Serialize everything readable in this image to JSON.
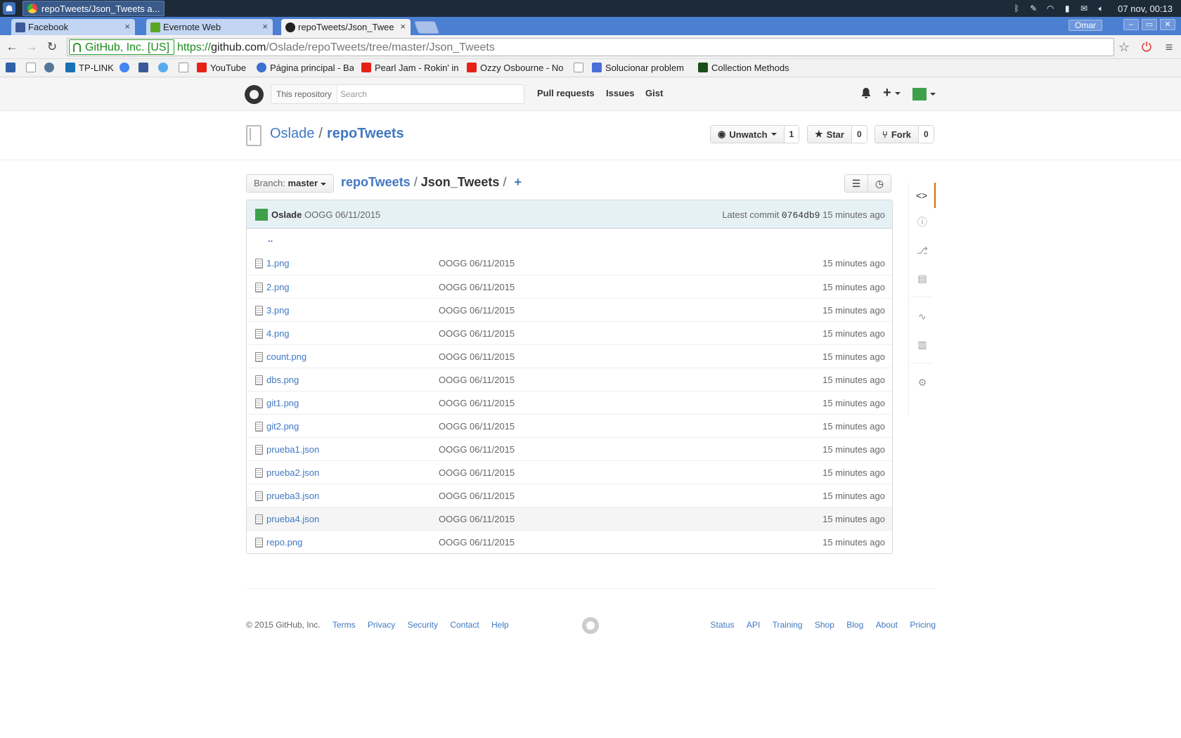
{
  "desktop": {
    "task_title": "repoTweets/Json_Tweets a...",
    "clock": "07 nov, 00:13"
  },
  "browser": {
    "tabs": [
      {
        "label": "Facebook",
        "close": "×",
        "favicon_color": "#3b5998"
      },
      {
        "label": "Evernote Web",
        "close": "×",
        "favicon_color": "#5ba525"
      },
      {
        "label": "repoTweets/Json_Twee",
        "close": "×",
        "favicon_color": "#222222"
      }
    ],
    "user": "Omar",
    "window_buttons": [
      "–",
      "▭",
      "✕"
    ],
    "address": {
      "ev_label": "GitHub, Inc. [US]",
      "scheme": "https://",
      "host": "github.com",
      "path": "/Oslade/repoTweets/tree/master/Json_Tweets"
    },
    "bookmarks": [
      {
        "label": "",
        "color": "#2f5fa8"
      },
      {
        "label": "",
        "color": "#bbbbbb"
      },
      {
        "label": "",
        "color": "#557799"
      },
      {
        "label": "TP-LINK",
        "color": "#1a6fb7"
      },
      {
        "label": "",
        "color": "#4285f4"
      },
      {
        "label": "",
        "color": "#3b5998"
      },
      {
        "label": "",
        "color": "#55acee"
      },
      {
        "label": "",
        "color": "#bbbbbb"
      },
      {
        "label": "YouTube",
        "color": "#e62117"
      },
      {
        "label": "Página principal - Ba",
        "color": "#3b6fd0"
      },
      {
        "label": "Pearl Jam - Rokin' in",
        "color": "#e62117"
      },
      {
        "label": "Ozzy Osbourne - No",
        "color": "#e62117"
      },
      {
        "label": "",
        "color": "#bbbbbb"
      },
      {
        "label": "Solucionar problem",
        "color": "#4a6fd8"
      },
      {
        "label": "Collection Methods",
        "color": "#1b4d1b"
      }
    ]
  },
  "github": {
    "search_scope": "This repository",
    "search_placeholder": "Search",
    "nav": [
      "Pull requests",
      "Issues",
      "Gist"
    ],
    "plus": "+",
    "owner": "Oslade",
    "slash": "/",
    "repo": "repoTweets",
    "watch": {
      "label": "Unwatch",
      "count": "1"
    },
    "star": {
      "label": "Star",
      "count": "0"
    },
    "fork": {
      "label": "Fork",
      "count": "0"
    },
    "branch_prefix": "Branch:",
    "branch": "master",
    "breadcrumb": {
      "repo": "repoTweets",
      "sep": "/",
      "current": "Json_Tweets",
      "sep2": "/",
      "add": "+"
    },
    "commit": {
      "author": "Oslade",
      "message": "OOGG 06/11/2015",
      "latest_prefix": "Latest commit",
      "sha": "0764db9",
      "age": "15 minutes ago"
    },
    "parent_link": "..",
    "files": [
      {
        "name": "1.png",
        "message": "OOGG 06/11/2015",
        "age": "15 minutes ago"
      },
      {
        "name": "2.png",
        "message": "OOGG 06/11/2015",
        "age": "15 minutes ago"
      },
      {
        "name": "3.png",
        "message": "OOGG 06/11/2015",
        "age": "15 minutes ago"
      },
      {
        "name": "4.png",
        "message": "OOGG 06/11/2015",
        "age": "15 minutes ago"
      },
      {
        "name": "count.png",
        "message": "OOGG 06/11/2015",
        "age": "15 minutes ago"
      },
      {
        "name": "dbs.png",
        "message": "OOGG 06/11/2015",
        "age": "15 minutes ago"
      },
      {
        "name": "git1.png",
        "message": "OOGG 06/11/2015",
        "age": "15 minutes ago"
      },
      {
        "name": "git2.png",
        "message": "OOGG 06/11/2015",
        "age": "15 minutes ago"
      },
      {
        "name": "prueba1.json",
        "message": "OOGG 06/11/2015",
        "age": "15 minutes ago"
      },
      {
        "name": "prueba2.json",
        "message": "OOGG 06/11/2015",
        "age": "15 minutes ago"
      },
      {
        "name": "prueba3.json",
        "message": "OOGG 06/11/2015",
        "age": "15 minutes ago"
      },
      {
        "name": "prueba4.json",
        "message": "OOGG 06/11/2015",
        "age": "15 minutes ago"
      },
      {
        "name": "repo.png",
        "message": "OOGG 06/11/2015",
        "age": "15 minutes ago"
      }
    ],
    "sidebar_icons": [
      "code-icon",
      "issues-icon",
      "pull-requests-icon",
      "wiki-icon",
      "pulse-icon",
      "graphs-icon",
      "settings-icon"
    ],
    "footer": {
      "copyright": "© 2015 GitHub, Inc.",
      "left_links": [
        "Terms",
        "Privacy",
        "Security",
        "Contact",
        "Help"
      ],
      "right_links": [
        "Status",
        "API",
        "Training",
        "Shop",
        "Blog",
        "About",
        "Pricing"
      ]
    }
  },
  "colors": {
    "link": "#4078c0",
    "tab_strip": "#4b7fd1",
    "commit_bg": "#e6f1f6",
    "accent_sidebar": "#d26911",
    "avatar": "#3fa04b"
  }
}
